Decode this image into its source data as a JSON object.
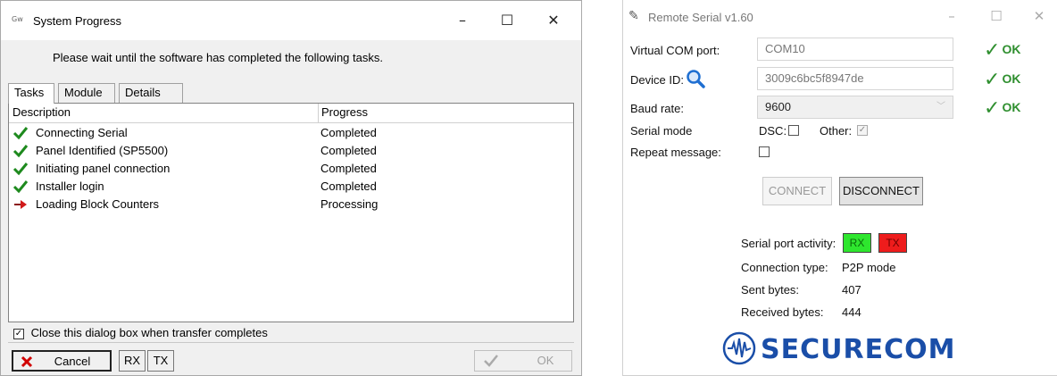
{
  "system_progress": {
    "window_title": "System Progress",
    "app_icon_text": "Gw",
    "message": "Please wait until the software has completed the following tasks.",
    "tabs": [
      {
        "label": "Tasks",
        "active": true
      },
      {
        "label": "Module",
        "active": false
      },
      {
        "label": "Details",
        "active": false
      }
    ],
    "columns": {
      "description": "Description",
      "progress": "Progress"
    },
    "tasks": [
      {
        "description": "Connecting Serial",
        "progress": "Completed",
        "icon": "check-icon"
      },
      {
        "description": "Panel Identified (SP5500)",
        "progress": "Completed",
        "icon": "check-icon"
      },
      {
        "description": "Initiating panel connection",
        "progress": "Completed",
        "icon": "check-icon"
      },
      {
        "description": "Installer login",
        "progress": "Completed",
        "icon": "check-icon"
      },
      {
        "description": "Loading Block Counters",
        "progress": "Processing",
        "icon": "arrow-right-icon"
      }
    ],
    "close_when_complete": {
      "label": "Close this dialog box when transfer completes",
      "checked": true
    },
    "buttons": {
      "cancel": "Cancel",
      "rx": "RX",
      "tx": "TX",
      "ok": "OK"
    }
  },
  "remote_serial": {
    "window_title": "Remote Serial v1.60",
    "virtual_com_port": {
      "label": "Virtual COM port:",
      "value": "COM10",
      "status": "OK"
    },
    "device_id": {
      "label": "Device ID:",
      "value": "3009c6bc5f8947de",
      "status": "OK"
    },
    "baud_rate": {
      "label": "Baud rate:",
      "value": "9600",
      "status": "OK"
    },
    "serial_mode": {
      "label": "Serial mode",
      "dsc_label": "DSC:",
      "dsc_checked": false,
      "other_label": "Other:",
      "other_checked": true
    },
    "repeat_message": {
      "label": "Repeat message:",
      "checked": false
    },
    "buttons": {
      "connect": "CONNECT",
      "disconnect": "DISCONNECT"
    },
    "serial_port_activity": {
      "label": "Serial port activity:",
      "rx": "RX",
      "tx": "TX"
    },
    "connection_type": {
      "label": "Connection type:",
      "value": "P2P mode"
    },
    "sent_bytes": {
      "label": "Sent bytes:",
      "value": "407"
    },
    "received_bytes": {
      "label": "Received bytes:",
      "value": "444"
    },
    "logo_text": "SECURECOM",
    "colors": {
      "ok_green": "#2f8f2f",
      "rx_led": "#2ee62e",
      "tx_led": "#ee1c1c",
      "logo_blue": "#1a4ea8"
    }
  }
}
